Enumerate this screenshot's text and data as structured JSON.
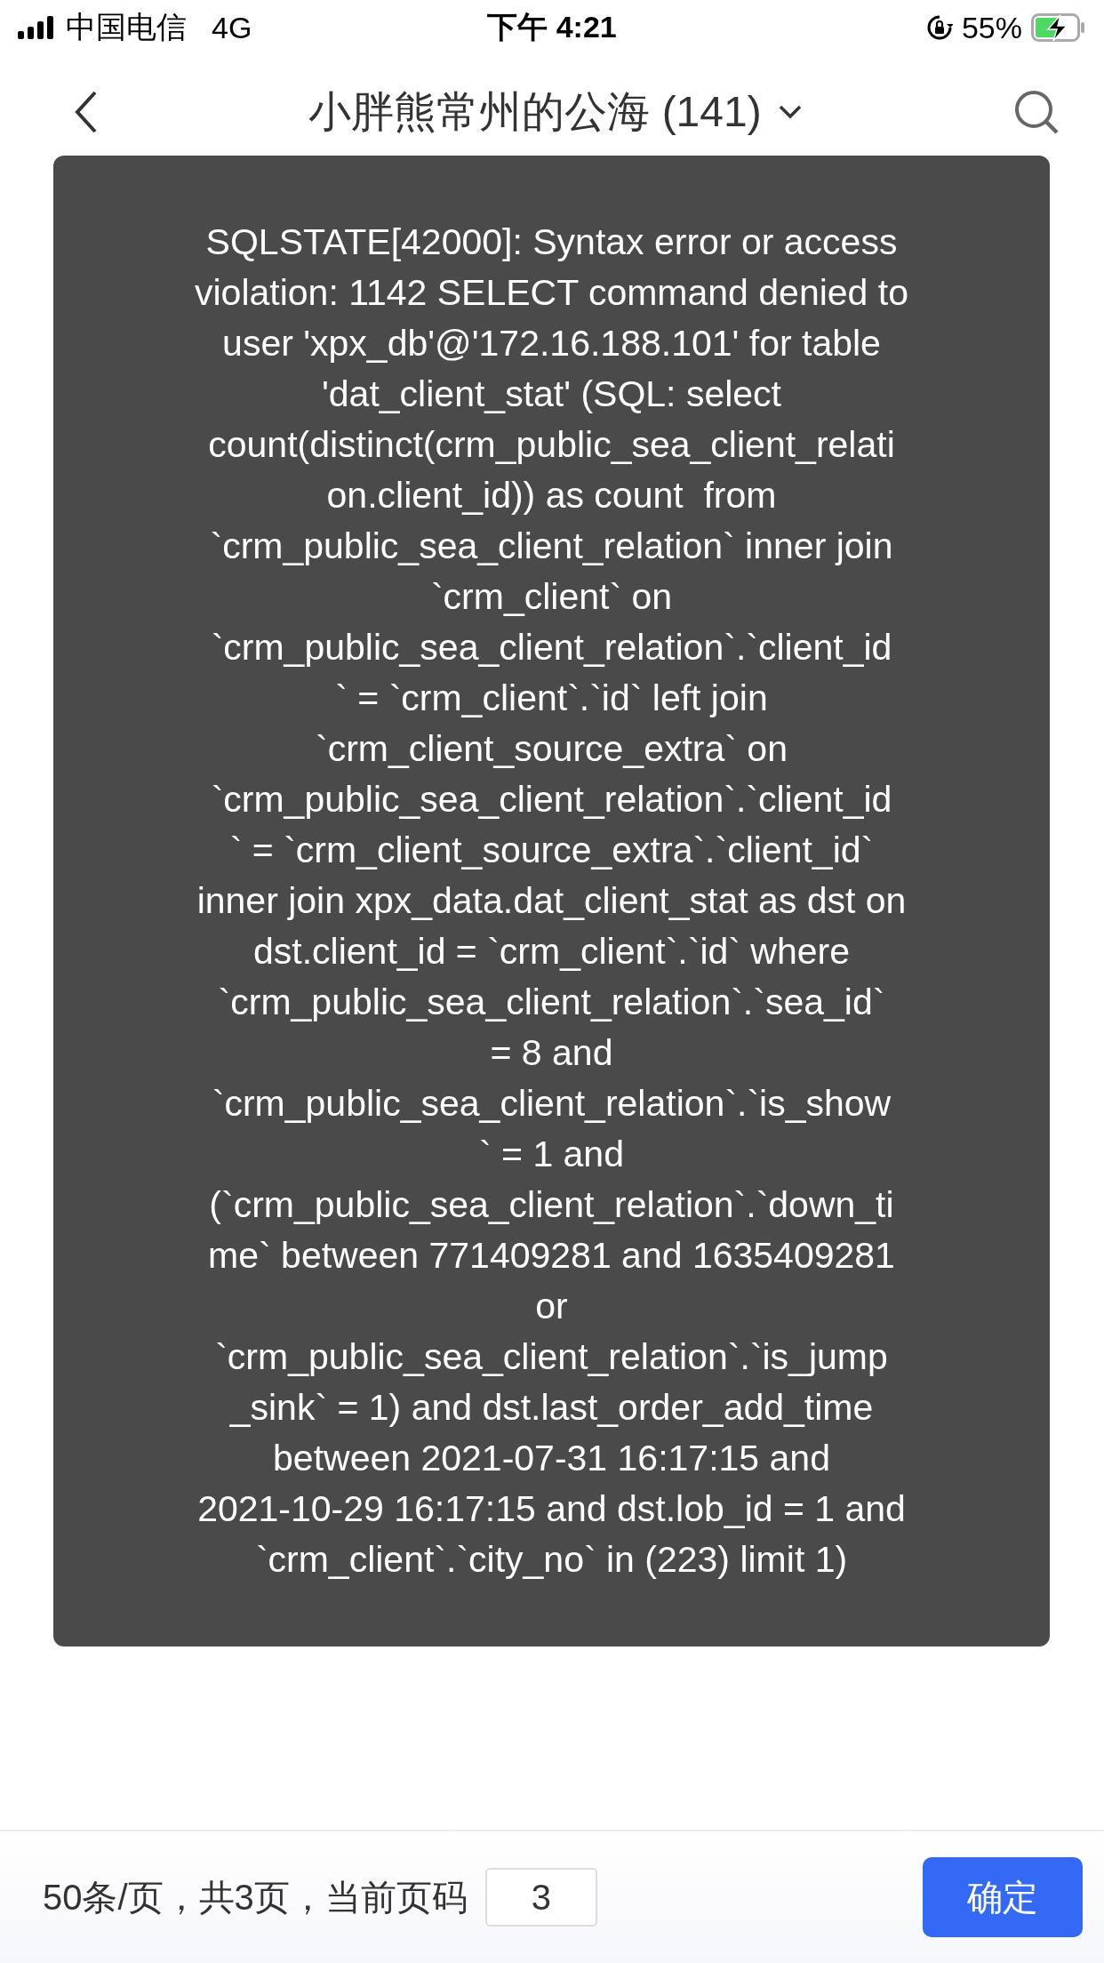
{
  "status_bar": {
    "carrier": "中国电信",
    "network": "4G",
    "time": "下午 4:21",
    "battery": "55%"
  },
  "nav": {
    "title": "小胖熊常州的公海 (141)"
  },
  "toast": {
    "message": "SQLSTATE[42000]: Syntax error or access\nviolation: 1142 SELECT command denied to\nuser 'xpx_db'@'172.16.188.101' for table\n'dat_client_stat' (SQL: select\ncount(distinct(crm_public_sea_client_relati\non.client_id)) as count  from\n`crm_public_sea_client_relation` inner join\n`crm_client` on\n`crm_public_sea_client_relation`.`client_id\n` = `crm_client`.`id` left join\n`crm_client_source_extra` on\n`crm_public_sea_client_relation`.`client_id\n` = `crm_client_source_extra`.`client_id`\ninner join xpx_data.dat_client_stat as dst on\ndst.client_id = `crm_client`.`id` where\n`crm_public_sea_client_relation`.`sea_id`\n= 8 and\n`crm_public_sea_client_relation`.`is_show\n` = 1 and\n(`crm_public_sea_client_relation`.`down_ti\nme` between 771409281 and 1635409281\nor\n`crm_public_sea_client_relation`.`is_jump\n_sink` = 1) and dst.last_order_add_time\nbetween 2021-07-31 16:17:15 and\n2021-10-29 16:17:15 and dst.lob_id = 1 and\n`crm_client`.`city_no` in (223) limit 1)"
  },
  "pagination": {
    "info": "50条/页，共3页，当前页码",
    "page_input": "3",
    "confirm_button": "确定"
  }
}
